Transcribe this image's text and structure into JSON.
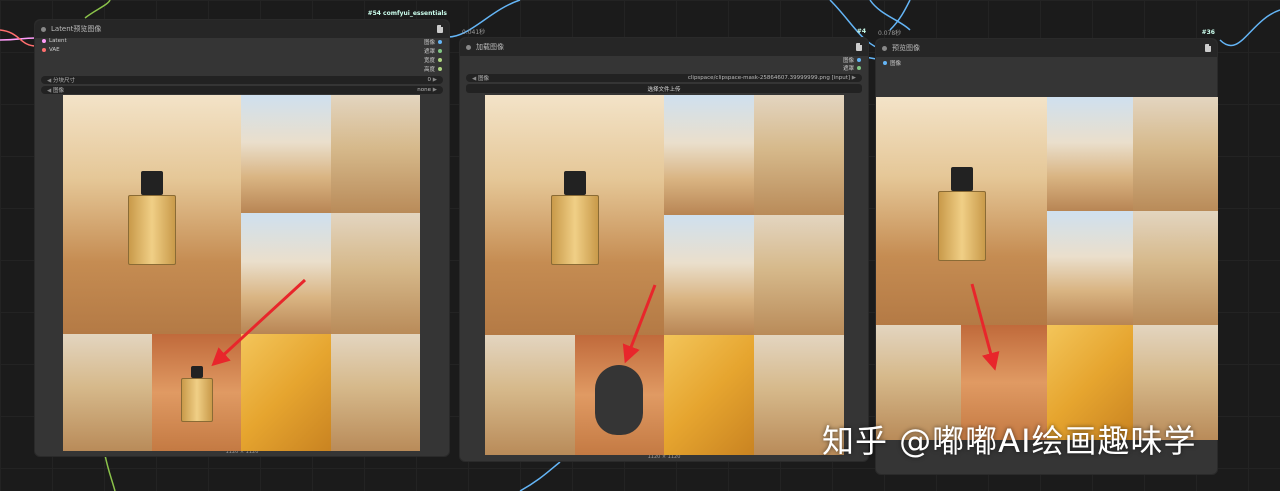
{
  "canvas": {
    "background": "#1b1b1b"
  },
  "node1": {
    "id_badge": "#54 comfyui_essentials",
    "title": "Latent预览图像",
    "inputs": [
      {
        "label": "Latent",
        "color": "#ff9cf9"
      },
      {
        "label": "VAE",
        "color": "#ff6e6e"
      }
    ],
    "outputs": [
      {
        "label": "图像"
      },
      {
        "label": "遮罩"
      },
      {
        "label": "宽度"
      },
      {
        "label": "高度"
      }
    ],
    "widget_size": {
      "label": "分块尺寸",
      "value": "0"
    },
    "widget_image": {
      "label": "图像",
      "value": "none"
    },
    "dims": "1120 × 1120"
  },
  "node2": {
    "id_badge": "#4",
    "timing": "0.041秒",
    "title": "加载图像",
    "outputs": [
      {
        "label": "图像"
      },
      {
        "label": "遮罩"
      }
    ],
    "widget_image": {
      "label": "图像",
      "value": "clipspace/clipspace-mask-25864607.39999999.png [input]"
    },
    "upload_button": "选择文件上传",
    "dims": "1120 × 1120"
  },
  "node3": {
    "id_badge": "#36",
    "timing": "0.078秒",
    "title": "预览图像",
    "inputs": [
      {
        "label": "图像"
      }
    ]
  },
  "watermark": "知乎 @嘟嘟AI绘画趣味学",
  "colors": {
    "arrow": "#e8262b",
    "wire_blue": "#64b5f6",
    "wire_pink": "#ff9cf9",
    "wire_green": "#8bc34a",
    "mask_fill": "#353535"
  }
}
